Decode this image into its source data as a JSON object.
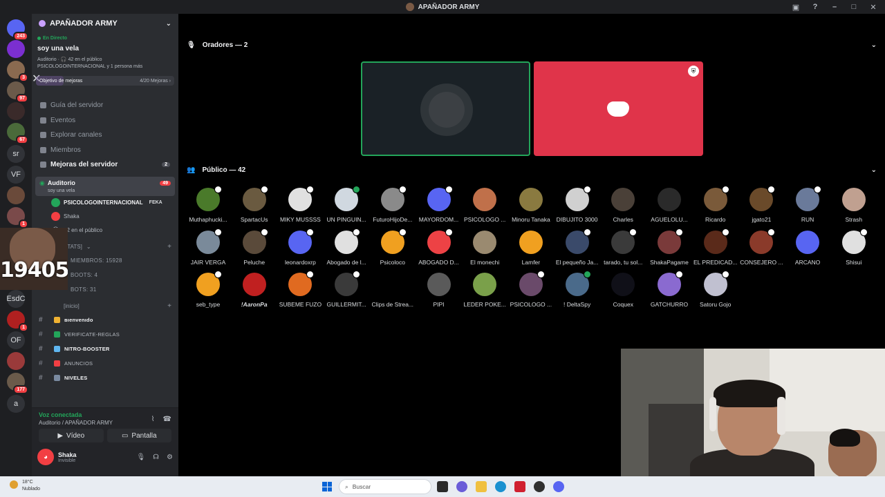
{
  "window": {
    "title": "APAÑADOR ARMY"
  },
  "servers": [
    {
      "label": "",
      "badge": "243",
      "color": "#5865f2"
    },
    {
      "label": "",
      "badge": "",
      "color": "#7b2fd0"
    },
    {
      "label": "",
      "badge": "3",
      "color": "#8a6a50"
    },
    {
      "label": "",
      "badge": "97",
      "color": "#6b5a4a"
    },
    {
      "label": "",
      "badge": "",
      "color": "#3a2a2a"
    },
    {
      "label": "",
      "badge": "67",
      "color": "#4a6a3a"
    },
    {
      "label": "sr",
      "badge": "",
      "color": "#313338"
    },
    {
      "label": "VF",
      "badge": "",
      "color": "#313338"
    },
    {
      "label": "",
      "badge": "",
      "color": "#6a4a3a"
    },
    {
      "label": "",
      "badge": "1",
      "color": "#7a4a4a"
    },
    {
      "label": "EsdC",
      "badge": "",
      "color": "#313338"
    },
    {
      "label": "",
      "badge": "1",
      "color": "#b02020"
    },
    {
      "label": "OF",
      "badge": "",
      "color": "#313338"
    },
    {
      "label": "",
      "badge": "",
      "color": "#9a3a3a"
    },
    {
      "label": "",
      "badge": "177",
      "color": "#6a5a4a"
    },
    {
      "label": "a",
      "badge": "",
      "color": "#313338"
    }
  ],
  "sidebar": {
    "server_name": "APAÑADOR ARMY",
    "live": {
      "label": "En Directo",
      "stage_name": "soy una vela",
      "meta": "Auditorio · 🎧 42 en el público",
      "speakers": "PSICOLOGOINTERNACIONAL y 1 persona más"
    },
    "goal": {
      "label": "Objetivo de mejoras",
      "value": "4/20 Mejoras ›",
      "progress": 0.2
    },
    "menu": [
      {
        "label": "Guía del servidor",
        "count": ""
      },
      {
        "label": "Eventos",
        "count": ""
      },
      {
        "label": "Explorar canales",
        "count": ""
      },
      {
        "label": "Miembros",
        "count": ""
      },
      {
        "label": "Mejoras del servidor",
        "count": "2"
      }
    ],
    "active_channel": {
      "name": "Auditorio",
      "topic": "soy una vela",
      "count": "49"
    },
    "channel_members": [
      {
        "name": "PSICOLOGOINTERNACIONAL",
        "tag": "FEKA"
      },
      {
        "name": "Shaka",
        "tag": ""
      },
      {
        "name": "42 en el público",
        "tag": ""
      }
    ],
    "stats_category": "STATS]",
    "stats": [
      "MIEMBROS: 15928",
      "BOOTS: 4",
      "BOTS: 31"
    ],
    "inicio_category": "[inicio]",
    "channels": [
      {
        "name": "вιenvenιdo",
        "bold": true,
        "color": "#f0b232"
      },
      {
        "name": "VERIFICATE-REGLAS",
        "bold": false,
        "color": "#23a55a"
      },
      {
        "name": "NITRO-BOOSTER",
        "bold": true,
        "color": "#5fb6f0"
      },
      {
        "name": "ANUNCIOS",
        "bold": false,
        "color": "#f23f43"
      },
      {
        "name": "NIVELES",
        "bold": true,
        "color": "#7a8aa0"
      }
    ]
  },
  "overlay": {
    "counter": "19405"
  },
  "voice": {
    "status": "Voz conectada",
    "path": "Auditorio / APAÑADOR ARMY",
    "video_label": "Vídeo",
    "screen_label": "Pantalla"
  },
  "user": {
    "name": "Shaka",
    "status": "Invisible"
  },
  "stage": {
    "speakers_title": "Oradores — 2",
    "audience_title": "Público — 42",
    "audience": [
      {
        "name": "Muthaphucki...",
        "color": "#4a7a2a",
        "mod": "white"
      },
      {
        "name": "SpartacUs",
        "color": "#6a5a40",
        "mod": "white"
      },
      {
        "name": "MIKY MUSSSS",
        "color": "#e0e0e0",
        "mod": "white"
      },
      {
        "name": "UN PINGUIN...",
        "color": "#d0d8e0",
        "mod": "green"
      },
      {
        "name": "FuturoHijoDe...",
        "color": "#8a8a8a",
        "mod": "white"
      },
      {
        "name": "MAYORDOM...",
        "color": "#5865f2",
        "mod": "white"
      },
      {
        "name": "PSICOLOGO ...",
        "color": "#c0704a",
        "mod": ""
      },
      {
        "name": "Minoru Tanaka",
        "color": "#8a7a40",
        "mod": ""
      },
      {
        "name": "DIBUJITO 3000",
        "color": "#d0d0d0",
        "mod": "white"
      },
      {
        "name": "Charles",
        "color": "#4a4038",
        "mod": ""
      },
      {
        "name": "AGUELOLU...",
        "color": "#2a2a2a",
        "mod": ""
      },
      {
        "name": "Ricardo",
        "color": "#7a5a3a",
        "mod": "white"
      },
      {
        "name": "jgato21",
        "color": "#6a4a2a",
        "mod": "white"
      },
      {
        "name": "RUN",
        "color": "#6a7a9a",
        "mod": "white"
      },
      {
        "name": "Strash",
        "color": "#c0a090",
        "mod": ""
      },
      {
        "name": "JAIR VERGA",
        "color": "#7a8a9a",
        "mod": "white"
      },
      {
        "name": "Peluche",
        "color": "#5a4a3a",
        "mod": "white"
      },
      {
        "name": "leonardoxrp",
        "color": "#5865f2",
        "mod": "white"
      },
      {
        "name": "Abogado de l...",
        "color": "#e0e0e0",
        "mod": "white"
      },
      {
        "name": "Psicoloco",
        "color": "#f0a020",
        "mod": "white"
      },
      {
        "name": "ABOGADO D...",
        "color": "#ed4245",
        "mod": "white"
      },
      {
        "name": "El monechi",
        "color": "#9a8a70",
        "mod": ""
      },
      {
        "name": "Lamfer",
        "color": "#f0a020",
        "mod": ""
      },
      {
        "name": "El pequeño Ja...",
        "color": "#3a4a6a",
        "mod": "white"
      },
      {
        "name": "tarado, tu sol...",
        "color": "#3a3a3a",
        "mod": "white"
      },
      {
        "name": "ShakaPagame",
        "color": "#7a3a3a",
        "mod": "white"
      },
      {
        "name": "EL PREDICAD...",
        "color": "#5a2a1a",
        "mod": "white"
      },
      {
        "name": "CONSEJERO ...",
        "color": "#8a3a2a",
        "mod": "white"
      },
      {
        "name": "ARCANO",
        "color": "#5865f2",
        "mod": ""
      },
      {
        "name": "Shisui",
        "color": "#e0e0e0",
        "mod": "white"
      },
      {
        "name": "seb_type",
        "color": "#f0a020",
        "mod": "white"
      },
      {
        "name": "!AaronPa",
        "color": "#c02020",
        "mod": ""
      },
      {
        "name": "SUBEME FUZO",
        "color": "#e06a20",
        "mod": "white"
      },
      {
        "name": "GUILLERMIT...",
        "color": "#3a3a3a",
        "mod": "white"
      },
      {
        "name": "Clips de Strea...",
        "color": "#000000",
        "mod": ""
      },
      {
        "name": "PIPI",
        "color": "#5a5a5a",
        "mod": ""
      },
      {
        "name": "LEDER POKE...",
        "color": "#7aa04a",
        "mod": ""
      },
      {
        "name": "PSICOLOGO ...",
        "color": "#6a4a6a",
        "mod": "white"
      },
      {
        "name": "! DeltaSpy",
        "color": "#4a6a8a",
        "mod": "green"
      },
      {
        "name": "Coquex",
        "color": "#101018",
        "mod": ""
      },
      {
        "name": "GATCHURRO",
        "color": "#8a6ad0",
        "mod": "white"
      },
      {
        "name": "Satoru Gojo",
        "color": "#c0c0d0",
        "mod": "white"
      }
    ]
  },
  "taskbar": {
    "temp": "18°C",
    "weather": "Nublado",
    "search_placeholder": "Buscar"
  }
}
